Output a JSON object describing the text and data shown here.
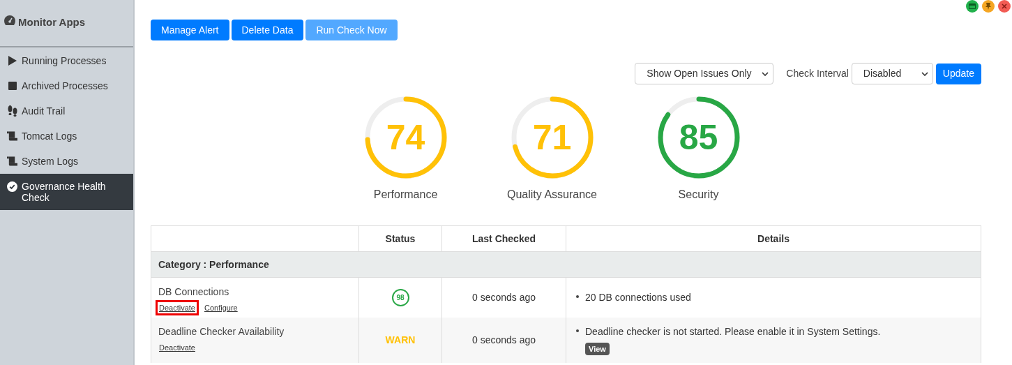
{
  "window_controls": [
    {
      "kind": "minimize",
      "color": "#22b14c"
    },
    {
      "kind": "pin",
      "color": "#f5a623"
    },
    {
      "kind": "close",
      "color": "#f25c54"
    }
  ],
  "sidebar": {
    "title": "Monitor Apps",
    "items": [
      {
        "label": "Running Processes",
        "kind": "play",
        "selected": false
      },
      {
        "label": "Archived Processes",
        "kind": "stop",
        "selected": false
      },
      {
        "label": "Audit Trail",
        "kind": "footprints",
        "selected": false
      },
      {
        "label": "Tomcat Logs",
        "kind": "scroll",
        "selected": false
      },
      {
        "label": "System Logs",
        "kind": "scroll",
        "selected": false
      },
      {
        "label": "Governance Health Check",
        "kind": "check",
        "selected": true
      }
    ]
  },
  "toolbar": [
    {
      "label": "Manage Alert",
      "disabled": false
    },
    {
      "label": "Delete Data",
      "disabled": false
    },
    {
      "label": "Run Check Now",
      "disabled": true
    }
  ],
  "filters": {
    "issue_filter": "Show Open Issues Only",
    "interval_label": "Check Interval",
    "interval": "Disabled",
    "update_button": "Update"
  },
  "gauges": [
    {
      "value": "74",
      "label": "Performance",
      "level": 0.74,
      "color": "#ffc107"
    },
    {
      "value": "71",
      "label": "Quality Assurance",
      "level": 0.71,
      "color": "#ffc107"
    },
    {
      "value": "85",
      "label": "Security",
      "level": 0.85,
      "color": "#28a745"
    }
  ],
  "table": {
    "columns": [
      "Status",
      "Last Checked",
      "Details"
    ],
    "category": "Category : Performance",
    "rows": [
      {
        "name": "DB Connections",
        "actions": [
          {
            "label": "Deactivate",
            "highlighted": true
          },
          {
            "label": "Configure",
            "highlighted": false
          }
        ],
        "status": {
          "kind": "score",
          "text": "98",
          "color": "#28a745"
        },
        "last_checked": "0 seconds ago",
        "details": [
          "20 DB connections used"
        ],
        "view_button": null
      },
      {
        "name": "Deadline Checker Availability",
        "actions": [
          {
            "label": "Deactivate",
            "highlighted": false
          }
        ],
        "status": {
          "kind": "text",
          "text": "WARN",
          "color": "#ffc107"
        },
        "last_checked": "0 seconds ago",
        "details": [
          "Deadline checker is not started. Please enable it in System Settings."
        ],
        "view_button": "View"
      }
    ]
  }
}
